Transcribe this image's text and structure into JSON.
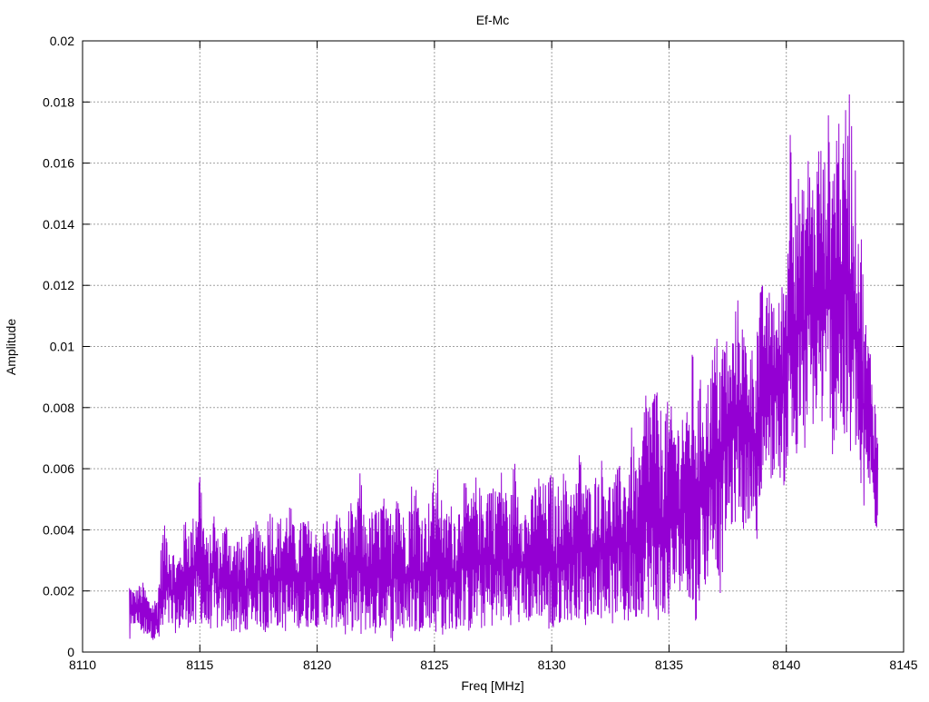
{
  "chart_data": {
    "type": "line",
    "title": "Ef-Mc",
    "xlabel": "Freq [MHz]",
    "ylabel": "Amplitude",
    "xlim": [
      8110,
      8145
    ],
    "ylim": [
      0,
      0.02
    ],
    "xticks": [
      8110,
      8115,
      8120,
      8125,
      8130,
      8135,
      8140,
      8145
    ],
    "xtick_labels": [
      "8110",
      "8115",
      "8120",
      "8125",
      "8130",
      "8135",
      "8140",
      "8145"
    ],
    "yticks": [
      0,
      0.002,
      0.004,
      0.006,
      0.008,
      0.01,
      0.012,
      0.014,
      0.016,
      0.018,
      0.02
    ],
    "ytick_labels": [
      "0",
      "0.002",
      "0.004",
      "0.006",
      "0.008",
      "0.01",
      "0.012",
      "0.014",
      "0.016",
      "0.018",
      "0.02"
    ],
    "grid": true,
    "legend": "none",
    "series": [
      {
        "color": "#9400d3",
        "x": [
          8112.0,
          8112.2,
          8112.4,
          8112.6,
          8112.8,
          8113.0,
          8113.2,
          8113.4,
          8113.6,
          8113.8,
          8114.0,
          8114.2,
          8114.4,
          8114.6,
          8114.8,
          8115.0,
          8115.2,
          8115.4,
          8115.6,
          8115.8,
          8116.0,
          8116.2,
          8116.4,
          8116.6,
          8116.8,
          8117.0,
          8117.2,
          8117.4,
          8117.6,
          8117.8,
          8118.0,
          8118.2,
          8118.4,
          8118.6,
          8118.8,
          8119.0,
          8119.2,
          8119.4,
          8119.6,
          8119.8,
          8120.0,
          8120.2,
          8120.4,
          8120.6,
          8120.8,
          8121.0,
          8121.2,
          8121.4,
          8121.6,
          8121.8,
          8122.0,
          8122.2,
          8122.4,
          8122.6,
          8122.8,
          8123.0,
          8123.2,
          8123.4,
          8123.6,
          8123.8,
          8124.0,
          8124.2,
          8124.4,
          8124.6,
          8124.8,
          8125.0,
          8125.2,
          8125.4,
          8125.6,
          8125.8,
          8126.0,
          8126.2,
          8126.4,
          8126.6,
          8126.8,
          8127.0,
          8127.2,
          8127.4,
          8127.6,
          8127.8,
          8128.0,
          8128.2,
          8128.4,
          8128.6,
          8128.8,
          8129.0,
          8129.2,
          8129.4,
          8129.6,
          8129.8,
          8130.0,
          8130.2,
          8130.4,
          8130.6,
          8130.8,
          8131.0,
          8131.2,
          8131.4,
          8131.6,
          8131.8,
          8132.0,
          8132.2,
          8132.4,
          8132.6,
          8132.8,
          8133.0,
          8133.2,
          8133.4,
          8133.6,
          8133.8,
          8134.0,
          8134.2,
          8134.4,
          8134.6,
          8134.8,
          8135.0,
          8135.2,
          8135.4,
          8135.6,
          8135.8,
          8136.0,
          8136.2,
          8136.4,
          8136.6,
          8136.8,
          8137.0,
          8137.2,
          8137.4,
          8137.6,
          8137.8,
          8138.0,
          8138.2,
          8138.4,
          8138.6,
          8138.8,
          8139.0,
          8139.2,
          8139.4,
          8139.6,
          8139.8,
          8140.0,
          8140.2,
          8140.4,
          8140.6,
          8140.8,
          8141.0,
          8141.2,
          8141.4,
          8141.6,
          8141.8,
          8142.0,
          8142.2,
          8142.4,
          8142.6,
          8142.8,
          8143.0,
          8143.2,
          8143.4,
          8143.6,
          8143.8,
          8143.9
        ],
        "upper": [
          0.0024,
          0.002,
          0.0022,
          0.0023,
          0.0018,
          0.0017,
          0.0019,
          0.0041,
          0.0042,
          0.0036,
          0.0031,
          0.0035,
          0.0046,
          0.0042,
          0.0047,
          0.0064,
          0.004,
          0.0036,
          0.0048,
          0.0036,
          0.0042,
          0.0044,
          0.0036,
          0.0039,
          0.0038,
          0.0036,
          0.0041,
          0.0043,
          0.0042,
          0.0039,
          0.0051,
          0.0042,
          0.0045,
          0.0044,
          0.0052,
          0.0042,
          0.0038,
          0.0047,
          0.0044,
          0.0039,
          0.0041,
          0.0042,
          0.0046,
          0.0036,
          0.0047,
          0.0045,
          0.0039,
          0.0051,
          0.0041,
          0.0063,
          0.0045,
          0.0044,
          0.0048,
          0.0047,
          0.0053,
          0.0045,
          0.0048,
          0.0065,
          0.0047,
          0.0044,
          0.0056,
          0.0057,
          0.0048,
          0.0046,
          0.0051,
          0.0058,
          0.0061,
          0.0044,
          0.005,
          0.0048,
          0.0047,
          0.0059,
          0.0053,
          0.0051,
          0.0059,
          0.0052,
          0.0055,
          0.006,
          0.0054,
          0.0061,
          0.0058,
          0.0046,
          0.0065,
          0.0055,
          0.005,
          0.0047,
          0.0053,
          0.006,
          0.0056,
          0.0055,
          0.0061,
          0.005,
          0.0063,
          0.0057,
          0.0058,
          0.0054,
          0.0068,
          0.0058,
          0.0055,
          0.0057,
          0.0062,
          0.0065,
          0.0056,
          0.0058,
          0.006,
          0.0063,
          0.0058,
          0.0074,
          0.0063,
          0.0064,
          0.0089,
          0.0087,
          0.009,
          0.0079,
          0.0085,
          0.0081,
          0.008,
          0.0077,
          0.0083,
          0.0078,
          0.01,
          0.0084,
          0.0092,
          0.0088,
          0.0096,
          0.0105,
          0.0101,
          0.0108,
          0.0097,
          0.0112,
          0.0118,
          0.0106,
          0.0104,
          0.0099,
          0.0118,
          0.0121,
          0.0116,
          0.0124,
          0.011,
          0.0122,
          0.0129,
          0.0185,
          0.0168,
          0.015,
          0.0155,
          0.0168,
          0.015,
          0.0172,
          0.016,
          0.0177,
          0.0165,
          0.0184,
          0.0162,
          0.0194,
          0.0178,
          0.015,
          0.0139,
          0.0108,
          0.01,
          0.0083,
          0.0074,
          0.0036
        ],
        "lower": [
          0.0002,
          0.0009,
          0.0008,
          0.0005,
          0.0006,
          0.0004,
          0.0003,
          0.0004,
          0.0008,
          0.0007,
          0.0006,
          0.0008,
          0.0007,
          0.0009,
          0.0006,
          0.001,
          0.0008,
          0.0007,
          0.0009,
          0.0007,
          0.0008,
          0.0009,
          0.0006,
          0.0007,
          0.0003,
          0.0007,
          0.001,
          0.0009,
          0.0008,
          0.0006,
          0.0008,
          0.0009,
          0.0008,
          0.0007,
          0.0006,
          0.0009,
          0.0008,
          0.0007,
          0.0008,
          0.001,
          0.0008,
          0.0008,
          0.0009,
          0.0007,
          0.0008,
          0.0009,
          0.0005,
          0.0006,
          0.0008,
          0.0003,
          0.0006,
          0.0009,
          0.0004,
          0.0007,
          0.0008,
          0.0009,
          0.0003,
          0.0008,
          0.0006,
          0.0007,
          0.0008,
          0.0005,
          0.0007,
          0.0009,
          0.0008,
          0.0006,
          0.0007,
          0.0005,
          0.0008,
          0.0006,
          0.0007,
          0.0009,
          0.0006,
          0.0008,
          0.001,
          0.0007,
          0.0009,
          0.0008,
          0.0009,
          0.001,
          0.0009,
          0.0008,
          0.0011,
          0.0009,
          0.0012,
          0.001,
          0.0008,
          0.0012,
          0.0011,
          0.0009,
          0.0004,
          0.0007,
          0.001,
          0.0011,
          0.0009,
          0.0012,
          0.001,
          0.0008,
          0.0011,
          0.0013,
          0.0012,
          0.001,
          0.0014,
          0.0009,
          0.0013,
          0.0011,
          0.0008,
          0.0012,
          0.0011,
          0.0012,
          0.0015,
          0.0009,
          0.0011,
          0.001,
          0.0007,
          0.0012,
          0.0018,
          0.0019,
          0.0022,
          0.002,
          0.0008,
          0.0009,
          0.0026,
          0.002,
          0.0035,
          0.003,
          0.0018,
          0.0038,
          0.004,
          0.0042,
          0.0046,
          0.0039,
          0.0043,
          0.0048,
          0.0019,
          0.006,
          0.0062,
          0.0055,
          0.0066,
          0.0051,
          0.0058,
          0.007,
          0.0052,
          0.0074,
          0.0065,
          0.0079,
          0.0072,
          0.008,
          0.007,
          0.0085,
          0.0061,
          0.0075,
          0.0071,
          0.0062,
          0.006,
          0.0068,
          0.0041,
          0.005,
          0.0053,
          0.0035,
          0.0045,
          0.0024,
          0.0012
        ]
      }
    ]
  }
}
